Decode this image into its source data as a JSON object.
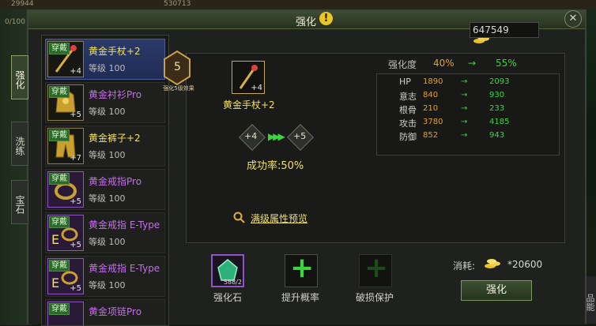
{
  "window": {
    "title": "强化"
  },
  "tabs": [
    {
      "label": "强化",
      "active": true
    },
    {
      "label": "洗练",
      "active": false
    },
    {
      "label": "宝石",
      "active": false
    }
  ],
  "gold": {
    "amount": "647549"
  },
  "items": [
    {
      "worn": "穿戴",
      "name": "黄金手杖+2",
      "level": "等级 100",
      "enhance": "+4",
      "rarity": "yellow",
      "selected": true
    },
    {
      "worn": "穿戴",
      "name": "黄金衬衫Pro",
      "level": "等级 100",
      "enhance": "+5",
      "rarity": "purple",
      "selected": false
    },
    {
      "worn": "穿戴",
      "name": "黄金裤子+2",
      "level": "等级 100",
      "enhance": "+7",
      "rarity": "yellow",
      "selected": false
    },
    {
      "worn": "穿戴",
      "name": "黄金戒指Pro",
      "level": "等级 100",
      "enhance": "+5",
      "rarity": "purple",
      "selected": false
    },
    {
      "worn": "穿戴",
      "name": "黄金戒指 E-Type",
      "level": "等级 100",
      "enhance": "+5",
      "rarity": "purple",
      "selected": false
    },
    {
      "worn": "穿戴",
      "name": "黄金戒指 E-Type",
      "level": "等级 100",
      "enhance": "+5",
      "rarity": "purple",
      "selected": false
    },
    {
      "worn": "穿戴",
      "name": "黄金项链Pro",
      "level": "",
      "enhance": "",
      "rarity": "purple",
      "selected": false
    }
  ],
  "enhance": {
    "badge_number": "5",
    "badge_caption": "强化5级效果",
    "target_name": "黄金手杖+2",
    "target_enhance": "+4",
    "from_level": "+4",
    "to_level": "+5",
    "arrows": "▶▶▶",
    "success_rate": "成功率:50%",
    "preview_link": "满级属性预览"
  },
  "stats": {
    "header": {
      "label": "强化度",
      "from": "40%",
      "arrow": "→",
      "to": "55%"
    },
    "rows": [
      {
        "name": "HP",
        "from": "1890",
        "arrow": "→",
        "to": "2093"
      },
      {
        "name": "意志",
        "from": "840",
        "arrow": "→",
        "to": "930"
      },
      {
        "name": "根骨",
        "from": "210",
        "arrow": "→",
        "to": "233"
      },
      {
        "name": "攻击",
        "from": "3780",
        "arrow": "→",
        "to": "4185"
      },
      {
        "name": "防御",
        "from": "852",
        "arrow": "→",
        "to": "943"
      }
    ]
  },
  "materials": {
    "stone_label": "强化石",
    "stone_count": "588/2",
    "rate_label": "提升概率",
    "protect_label": "破损保护",
    "plus": "+"
  },
  "cost": {
    "label": "消耗:",
    "value": "*20600"
  },
  "button": {
    "enhance": "强化"
  },
  "scene": {
    "top_left_1": "29944",
    "top_left_2": "0/100",
    "top_mid": "530713",
    "right_tab": "品能"
  },
  "icons": {
    "help": "!",
    "close": "✕"
  }
}
